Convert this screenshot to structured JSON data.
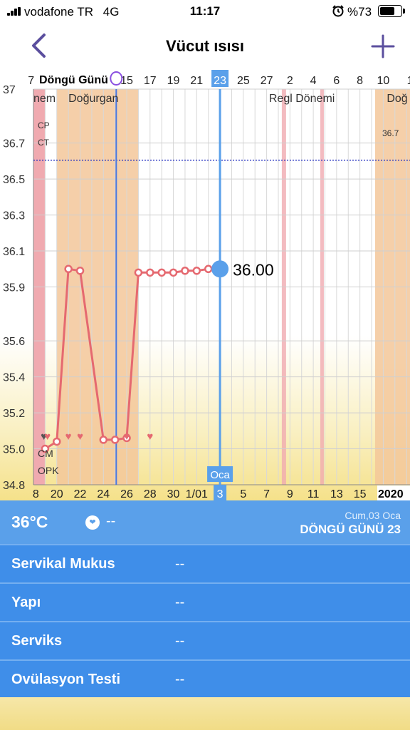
{
  "status_bar": {
    "carrier": "vodafone TR",
    "network": "4G",
    "time": "11:17",
    "battery": "%73",
    "battery_level": 0.73
  },
  "nav": {
    "title": "Vücut ısısı",
    "back_icon": "chevron-left-icon",
    "add_icon": "plus-icon",
    "accent": "#5b4f9e"
  },
  "chart": {
    "header_label": "Döngü Günü",
    "phase_labels": [
      "nem",
      "Doğurgan",
      "Regl Dönemi",
      "Doğ"
    ],
    "cp_label": "CP",
    "ct_label": "CT",
    "ct_value": "36.7",
    "cm_label": "CM",
    "opk_label": "OPK",
    "selected_value_label": "36.00",
    "selected_cycle_day": "23",
    "selected_date": "3",
    "month_badge": "Oca",
    "year_label": "2020",
    "colors": {
      "fertile": "#f3c79a",
      "period": "#f0aab0",
      "line": "#e56970",
      "selected": "#5aa0ea",
      "ovulation": "#4b78e0",
      "coverline": "#2430c0"
    }
  },
  "chart_data": {
    "type": "line",
    "ylim": [
      34.8,
      37
    ],
    "y_ticks": [
      "37",
      "36.7",
      "36.5",
      "36.3",
      "36.1",
      "35.9",
      "35.6",
      "35.4",
      "35.2",
      "35.0",
      "34.8"
    ],
    "cycle_day_ticks": [
      "7",
      "15",
      "17",
      "19",
      "21",
      "23",
      "25",
      "27",
      "2",
      "4",
      "6",
      "8",
      "10",
      "1"
    ],
    "date_ticks": [
      "8",
      "20",
      "22",
      "24",
      "26",
      "28",
      "30",
      "1/01",
      "3",
      "5",
      "7",
      "9",
      "11",
      "13",
      "15"
    ],
    "series": [
      {
        "x": [
          "19 Ara",
          "20 Ara",
          "21 Ara",
          "22 Ara",
          "24 Ara",
          "25 Ara",
          "26 Ara",
          "27 Ara",
          "28 Ara",
          "29 Ara",
          "30 Ara",
          "31 Ara",
          "1 Oca",
          "2 Oca",
          "3 Oca"
        ],
        "values": [
          35.0,
          35.04,
          36.0,
          35.99,
          35.05,
          35.05,
          35.06,
          35.98,
          35.98,
          35.98,
          35.98,
          35.99,
          35.99,
          36.0,
          36.0
        ]
      }
    ],
    "coverline": 36.7
  },
  "summary": {
    "temperature": "36°C",
    "intercourse_value": "--",
    "date": "Cum,03 Oca",
    "cycle_day": "DÖNGÜ GÜNÜ 23"
  },
  "details": [
    {
      "label": "Servikal Mukus",
      "value": "--"
    },
    {
      "label": "Yapı",
      "value": "--"
    },
    {
      "label": "Serviks",
      "value": "--"
    },
    {
      "label": "Ovülasyon Testi",
      "value": "--"
    }
  ]
}
